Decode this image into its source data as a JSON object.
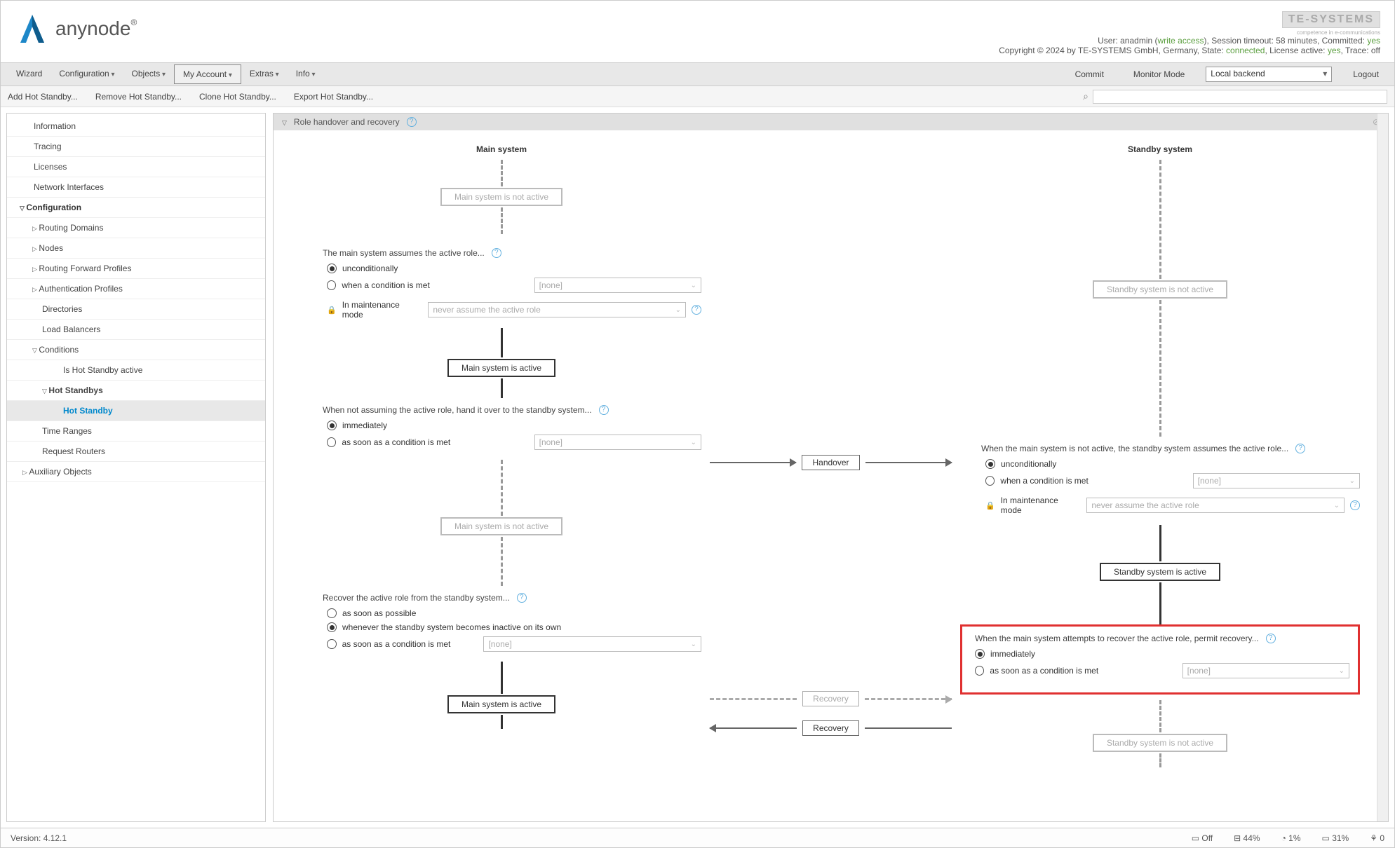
{
  "brand": {
    "name": "anynode"
  },
  "header_right": {
    "tesystems": "TE-SYSTEMS",
    "tesystems_sub": "competence in e-communications",
    "user_prefix": "User: ",
    "user": "anadmin",
    "write_access": "write access",
    "timeout_label": ", Session timeout: ",
    "timeout_value": "58 minutes",
    "committed_label": ", Committed: ",
    "committed_value": "yes",
    "copyright": "Copyright © 2024 by TE-SYSTEMS GmbH, Germany, State: ",
    "state_value": "connected",
    "license_label": ", License active: ",
    "license_value": "yes",
    "trace_label": ", Trace: ",
    "trace_value": "off"
  },
  "menubar": {
    "items": [
      "Wizard",
      "Configuration",
      "Objects",
      "My Account",
      "Extras",
      "Info"
    ],
    "commit": "Commit",
    "monitor": "Monitor Mode",
    "backend": "Local backend",
    "logout": "Logout"
  },
  "toolbar": {
    "add": "Add Hot Standby...",
    "remove": "Remove Hot Standby...",
    "clone": "Clone Hot Standby...",
    "export": "Export Hot Standby..."
  },
  "sidebar": {
    "information": "Information",
    "tracing": "Tracing",
    "licenses": "Licenses",
    "network_interfaces": "Network Interfaces",
    "configuration": "Configuration",
    "routing_domains": "Routing Domains",
    "nodes": "Nodes",
    "rfp": "Routing Forward Profiles",
    "auth_profiles": "Authentication Profiles",
    "directories": "Directories",
    "load_balancers": "Load Balancers",
    "conditions": "Conditions",
    "is_hs_active": "Is Hot Standby active",
    "hot_standbys": "Hot Standbys",
    "hot_standby": "Hot Standby",
    "time_ranges": "Time Ranges",
    "request_routers": "Request Routers",
    "aux_objects": "Auxiliary Objects"
  },
  "section": {
    "title": "Role handover and recovery"
  },
  "diagram": {
    "main_header": "Main system",
    "standby_header": "Standby system",
    "main_not_active": "Main system is not active",
    "main_active": "Main system is active",
    "standby_not_active": "Standby system is not active",
    "standby_active": "Standby system is active",
    "handover": "Handover",
    "recovery": "Recovery",
    "assumes_text": "The main system assumes the active role...",
    "unconditionally": "unconditionally",
    "when_condition": "when a condition is met",
    "none": "[none]",
    "maintenance_mode": "In maintenance mode",
    "never_assume": "never assume the active role",
    "not_assuming_text": "When not assuming the active role, hand it over to the standby system...",
    "immediately": "immediately",
    "as_soon_condition": "as soon as a condition is met",
    "recover_text": "Recover the active role from the standby system...",
    "as_soon_possible": "as soon as possible",
    "whenever_inactive": "whenever the standby system becomes inactive on its own",
    "standby_assumes_text": "When the main system is not active, the standby system assumes the active role...",
    "permit_recovery_text": "When the main system attempts to recover the active role, permit recovery..."
  },
  "footer": {
    "version_label": "Version: ",
    "version": "4.12.1",
    "stat_off": "Off",
    "stat_44": "44%",
    "stat_1": "1%",
    "stat_31": "31%",
    "stat_0": "0"
  }
}
